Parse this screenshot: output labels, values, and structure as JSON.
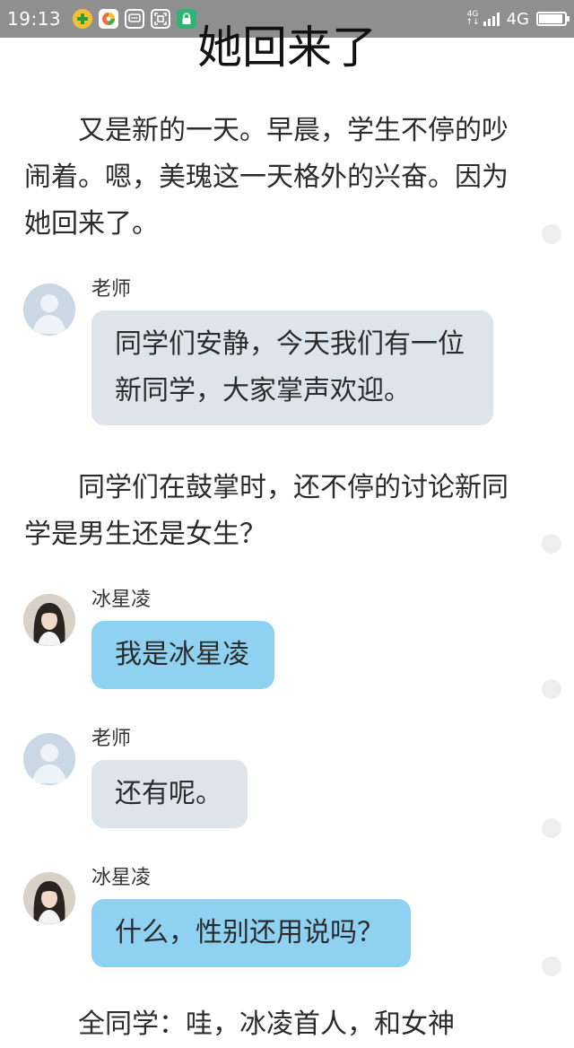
{
  "status_bar": {
    "time": "19:13",
    "network_small": "4G",
    "network_sub": "↑↓",
    "network": "4G",
    "icons": [
      "plus-app-icon",
      "photos-app-icon",
      "chat-app-icon",
      "scan-app-icon",
      "lock-app-icon"
    ]
  },
  "story": {
    "title": "她回来了",
    "paragraphs": [
      "又是新的一天。早晨，学生不停的吵闹着。嗯，美瑰这一天格外的兴奋。因为她回来了。",
      "同学们在鼓掌时，还不停的讨论新同学是男生还是女生？",
      "全同学：哇，冰凌首人，和女神"
    ]
  },
  "messages": [
    {
      "sender": "老师",
      "text": "同学们安静，今天我们有一位新同学，大家掌声欢迎。",
      "style": "gray"
    },
    {
      "sender": "冰星凌",
      "text": "我是冰星凌",
      "style": "blue"
    },
    {
      "sender": "老师",
      "text": "还有呢。",
      "style": "gray"
    },
    {
      "sender": "冰星凌",
      "text": "什么，性别还用说吗？",
      "style": "blue"
    }
  ],
  "colors": {
    "status_bar_bg": "#8f8f8f",
    "bubble_gray": "#dde5ea",
    "bubble_blue": "#8fd1f1",
    "text": "#2b2b2b"
  }
}
